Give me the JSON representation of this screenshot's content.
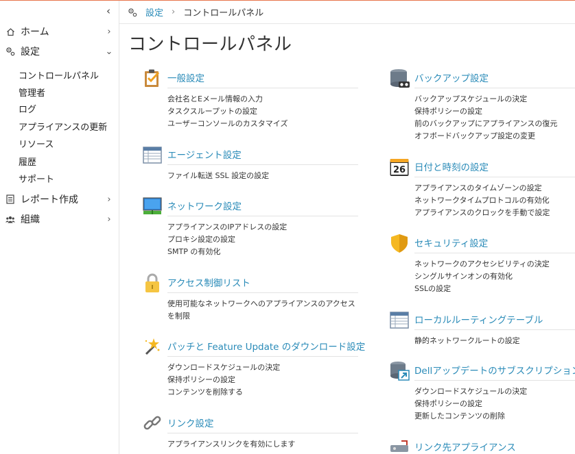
{
  "sidebar": {
    "collapse_glyph": "‹",
    "items": [
      {
        "label": "ホーム"
      },
      {
        "label": "設定"
      },
      {
        "label": "レポート作成"
      },
      {
        "label": "組織"
      }
    ],
    "settings_sub": [
      "コントロールパネル",
      "管理者",
      "ログ",
      "アプライアンスの更新",
      "リソース",
      "履歴",
      "サポート"
    ]
  },
  "breadcrumb": {
    "parent": "設定",
    "separator": "›",
    "current": "コントロールパネル"
  },
  "page_title": "コントロールパネル",
  "sections": [
    {
      "icon": "clipboard-check-icon",
      "title": "一般設定",
      "links": [
        "会社名とEメール情報の入力",
        "タスクスループットの設定",
        "ユーザーコンソールのカスタマイズ"
      ]
    },
    {
      "icon": "table-icon",
      "title": "エージェント設定",
      "links": [
        "ファイル転送 SSL 設定の設定"
      ]
    },
    {
      "icon": "monitor-network-icon",
      "title": "ネットワーク設定",
      "links": [
        "アプライアンスのIPアドレスの設定",
        "プロキシ設定の設定",
        "SMTP の有効化"
      ]
    },
    {
      "icon": "padlock-icon",
      "title": "アクセス制御リスト",
      "links": [
        "使用可能なネットワークへのアプライアンスのアクセス",
        "を制限"
      ]
    },
    {
      "icon": "magic-wand-icon",
      "title": "パッチと Feature Update のダウンロード設定",
      "links": [
        "ダウンロードスケジュールの決定",
        "保持ポリシーの設定",
        "コンテンツを削除する"
      ]
    },
    {
      "icon": "link-icon",
      "title": "リンク設定",
      "links": [
        "アプライアンスリンクを有効にします"
      ]
    },
    {
      "icon": "backup-drive-icon",
      "title": "バックアップ設定",
      "links": [
        "バックアップスケジュールの決定",
        "保持ポリシーの設定",
        "前のバックアップにアプライアンスの復元",
        "オフボードバックアップ設定の変更"
      ]
    },
    {
      "icon": "calendar-icon",
      "title": "日付と時刻の設定",
      "calendar_day": "26",
      "links": [
        "アプライアンスのタイムゾーンの設定",
        "ネットワークタイムプロトコルの有効化",
        "アプライアンスのクロックを手動で設定"
      ]
    },
    {
      "icon": "shield-icon",
      "title": "セキュリティ設定",
      "links": [
        "ネットワークのアクセシビリティの決定",
        "シングルサインオンの有効化",
        "SSLの設定"
      ]
    },
    {
      "icon": "routing-table-icon",
      "title": "ローカルルーティングテーブル",
      "links": [
        "静的ネットワークルートの設定"
      ]
    },
    {
      "icon": "database-update-icon",
      "title": "Dellアップデートのサブスクリプション",
      "links": [
        "ダウンロードスケジュールの決定",
        "保持ポリシーの設定",
        "更新したコンテンツの削除"
      ]
    },
    {
      "icon": "linked-appliance-icon",
      "title": "リンク先アプライアンス",
      "links": []
    }
  ],
  "colors": {
    "link": "#2a8bb8",
    "accent": "#e8734a"
  }
}
